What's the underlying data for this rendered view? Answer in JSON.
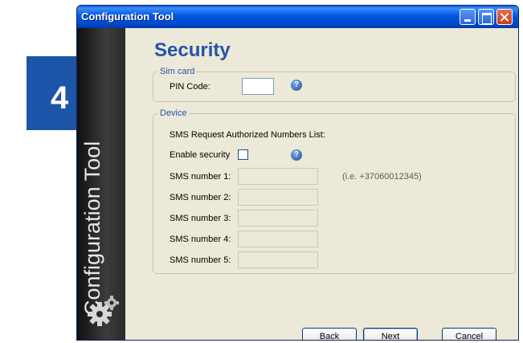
{
  "window": {
    "title": "Configuration Tool"
  },
  "sidebar": {
    "vertical_text": "Configuration Tool"
  },
  "step_badge": {
    "number": "4"
  },
  "page": {
    "title": "Security"
  },
  "sim_card": {
    "legend": "Sim card",
    "pin_label": "PIN Code:",
    "pin_value": ""
  },
  "device": {
    "legend": "Device",
    "list_title": "SMS Request Authorized Numbers List:",
    "enable_security_label": "Enable security",
    "enable_security_checked": false,
    "sms_example_hint": "(i.e. +37060012345)",
    "sms_numbers": [
      {
        "label": "SMS number 1:",
        "value": ""
      },
      {
        "label": "SMS number 2:",
        "value": ""
      },
      {
        "label": "SMS number 3:",
        "value": ""
      },
      {
        "label": "SMS number 4:",
        "value": ""
      },
      {
        "label": "SMS number 5:",
        "value": ""
      }
    ]
  },
  "buttons": {
    "back": "Back",
    "next": "Next",
    "cancel": "Cancel"
  },
  "colors": {
    "accent": "#2453a8",
    "badge": "#1d55a8",
    "titlebar": "#0058e6"
  },
  "icons": {
    "help": "help-icon",
    "gear": "gear-icon"
  }
}
